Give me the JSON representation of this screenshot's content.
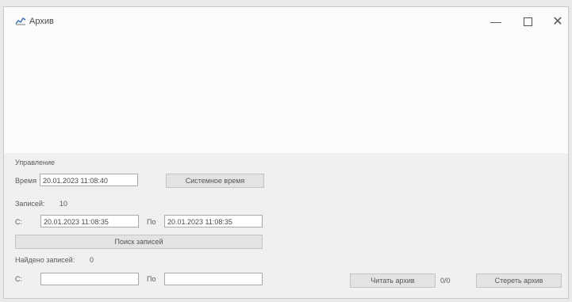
{
  "window": {
    "title": "Архив",
    "app_icon": "chart-app-icon",
    "minimize_icon": "minimize-icon",
    "maximize_icon": "maximize-icon",
    "close_icon": "close-icon",
    "close_glyph": "✕",
    "minimize_glyph": "—"
  },
  "control": {
    "group_label": "Управление",
    "time_label": "Время",
    "time_value": "20.01.2023 11:08:40",
    "system_time_button": "Системное время"
  },
  "records": {
    "label": "Записей:",
    "count": "10",
    "from_label": "С:",
    "from_value": "20.01.2023 11:08:35",
    "to_label": "По",
    "to_value": "20.01.2023 11:08:35",
    "search_button": "Поиск записей"
  },
  "found": {
    "label": "Найдено записей:",
    "count": "0",
    "from_label": "С:",
    "from_value": "",
    "to_label": "По",
    "to_value": "",
    "read_button": "Читать архив",
    "ratio": "0/0",
    "erase_button": "Стереть архив"
  }
}
